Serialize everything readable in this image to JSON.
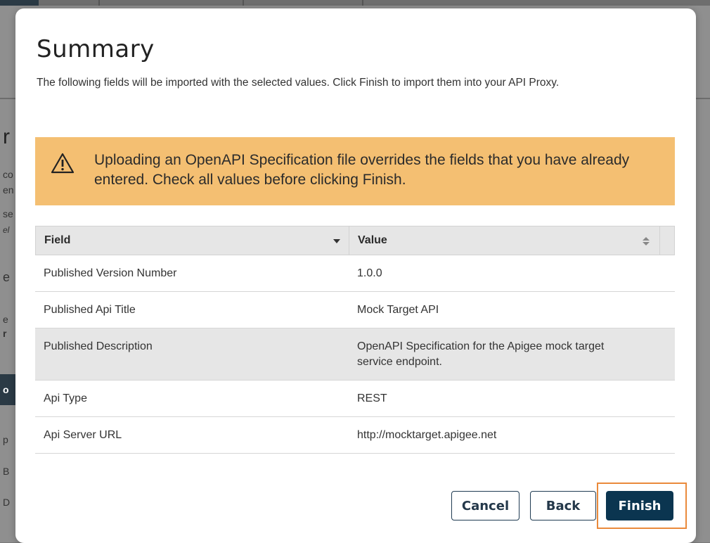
{
  "background": {
    "fragments": [
      "r",
      "co",
      "en",
      "se",
      "el",
      "e",
      "e",
      "r",
      "o",
      "p",
      "B",
      "D"
    ]
  },
  "modal": {
    "title": "Summary",
    "description": "The following fields will be imported with the selected values. Click Finish to import them into your API Proxy.",
    "warning": {
      "icon": "warning-triangle-icon",
      "text": "Uploading an OpenAPI Specification file overrides the fields that you have already entered. Check all values before clicking Finish.",
      "color": "#f4bf72"
    },
    "table": {
      "columns": [
        "Field",
        "Value"
      ],
      "rows": [
        {
          "field": "Published Version Number",
          "value": "1.0.0"
        },
        {
          "field": "Published Api Title",
          "value": "Mock Target API"
        },
        {
          "field": "Published Description",
          "value": "OpenAPI Specification for the Apigee mock target service endpoint."
        },
        {
          "field": "Api Type",
          "value": "REST"
        },
        {
          "field": "Api Server URL",
          "value": "http://mocktarget.apigee.net"
        }
      ]
    },
    "buttons": {
      "cancel": "Cancel",
      "back": "Back",
      "finish": "Finish"
    },
    "accent_color": "#0b3550",
    "focus_color": "#ea8a3b"
  }
}
